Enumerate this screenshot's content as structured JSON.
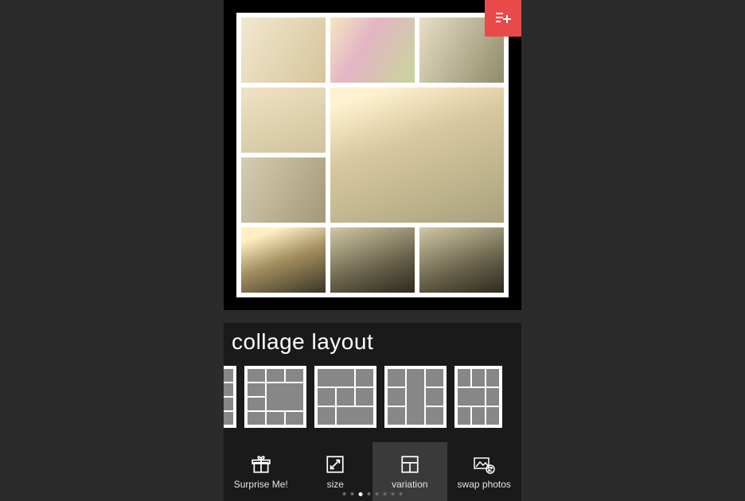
{
  "header": {
    "add_icon": "add-to-list-icon"
  },
  "section": {
    "title": "collage layout"
  },
  "bottom_tabs": {
    "surprise": "Surprise Me!",
    "size": "size",
    "variation": "variation",
    "swap": "swap photos",
    "selected": "variation"
  },
  "pager": {
    "count": 8,
    "active_index": 2
  },
  "colors": {
    "accent": "#e84a4a",
    "bg": "#2b2b2b",
    "panel": "#1a1a1a"
  }
}
